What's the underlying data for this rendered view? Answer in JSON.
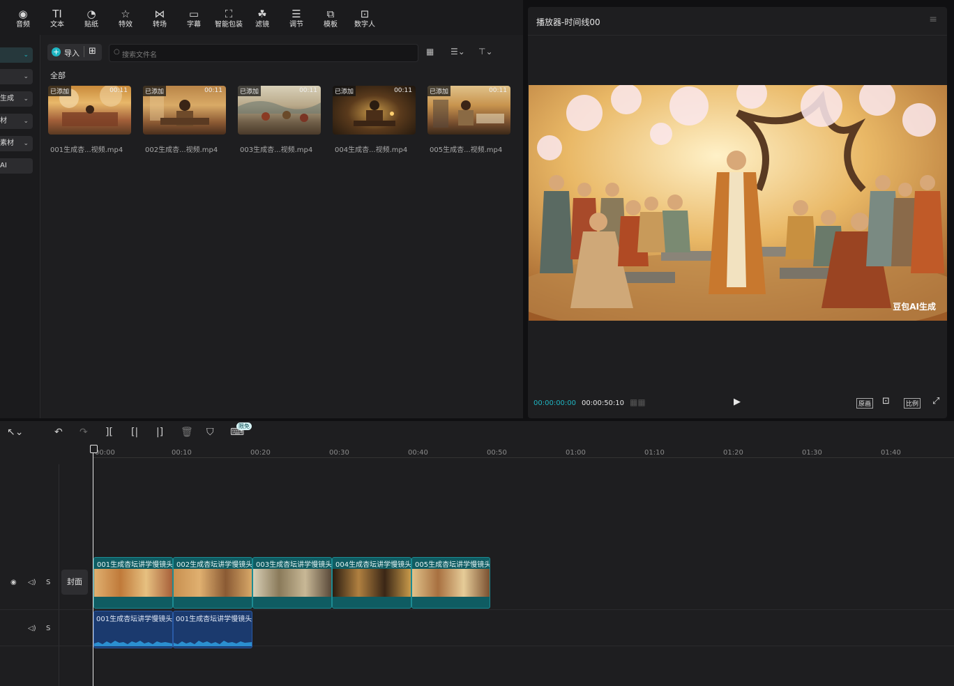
{
  "toolbar": [
    {
      "icon": "music-note-icon",
      "label": "音频"
    },
    {
      "icon": "text-icon",
      "label": "文本"
    },
    {
      "icon": "sticker-icon",
      "label": "贴纸"
    },
    {
      "icon": "star-icon",
      "label": "特效"
    },
    {
      "icon": "transition-icon",
      "label": "转场"
    },
    {
      "icon": "caption-icon",
      "label": "字幕"
    },
    {
      "icon": "smart-package-icon",
      "label": "智能包装"
    },
    {
      "icon": "filter-icon",
      "label": "滤镜"
    },
    {
      "icon": "adjust-icon",
      "label": "调节"
    },
    {
      "icon": "template-icon",
      "label": "模板"
    },
    {
      "icon": "digital-human-icon",
      "label": "数字人"
    }
  ],
  "sidebar": {
    "items": [
      "",
      "",
      "生成",
      "材",
      "素材",
      "AI"
    ]
  },
  "media": {
    "import_label": "导入",
    "search_placeholder": "搜索文件名",
    "category": "全部",
    "clips": [
      {
        "badge": "已添加",
        "duration": "00:11",
        "name": "001生成杏...视频.mp4"
      },
      {
        "badge": "已添加",
        "duration": "00:11",
        "name": "002生成杏...视频.mp4"
      },
      {
        "badge": "已添加",
        "duration": "00:11",
        "name": "003生成杏...视频.mp4"
      },
      {
        "badge": "已添加",
        "duration": "00:11",
        "name": "004生成杏...视频.mp4"
      },
      {
        "badge": "已添加",
        "duration": "00:11",
        "name": "005生成杏...视频.mp4"
      }
    ]
  },
  "player": {
    "title": "播放器-时间线00",
    "current_time": "00:00:00:00",
    "total_time": "00:00:50:10",
    "watermark": "豆包AI生成",
    "btn_original": "原画",
    "btn_ratio": "比例"
  },
  "timeline": {
    "limited_badge": "限免",
    "ticks": [
      "00:00",
      "00:10",
      "00:20",
      "00:30",
      "00:40",
      "00:50",
      "01:00",
      "01:10",
      "01:20",
      "01:30",
      "01:40"
    ],
    "cover_label": "封面",
    "track_s": "S",
    "video_clips": [
      "001生成杏坛讲学慢镜头",
      "002生成杏坛讲学慢镜头",
      "003生成杏坛讲学慢镜头",
      "004生成杏坛讲学慢镜头",
      "005生成杏坛讲学慢镜头"
    ],
    "audio_clips": [
      "001生成杏坛讲学慢镜头",
      "001生成杏坛讲学慢镜头"
    ]
  },
  "colors": {
    "accent": "#1fb5c2",
    "panel": "#1e1e20",
    "video_clip": "#0f5c62",
    "audio_clip": "#1b3a6e"
  }
}
